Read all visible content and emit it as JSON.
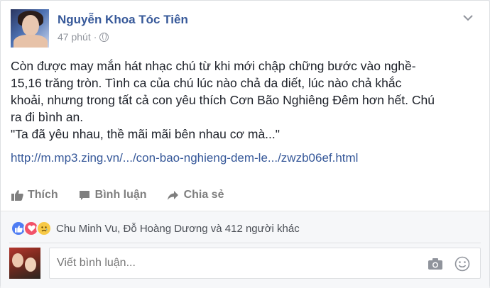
{
  "post": {
    "author": "Nguyễn Khoa Tóc Tiên",
    "time": "47 phút",
    "separator": "·",
    "privacy_icon": "globe-icon",
    "menu_icon": "chevron-down-icon",
    "text_lines": [
      "Còn được may mắn hát nhạc chú từ khi mới chập chững bước vào nghề-",
      "15,16 trăng tròn. Tình ca của chú lúc nào chả da diết, lúc nào chả khắc",
      "khoải, nhưng trong tất cả con yêu thích Cơn Bão Nghiêng Đêm hơn hết. Chú",
      "ra đi bình an.",
      "\"Ta đã yêu nhau, thề mãi mãi bên nhau cơ mà...\""
    ],
    "link": "http://m.mp3.zing.vn/.../con-bao-nghieng-dem-le.../zwzb06ef.html"
  },
  "actions": {
    "like": "Thích",
    "comment": "Bình luận",
    "share": "Chia sẻ"
  },
  "reactions": {
    "icons": [
      "like-icon",
      "love-icon",
      "sad-icon"
    ],
    "summary": "Chu Minh Vu, Đỗ Hoàng Dương và 412 người khác"
  },
  "comment": {
    "placeholder": "Viết bình luận..."
  },
  "colors": {
    "link": "#365899",
    "secondary": "#90949c",
    "action": "#7f7f7f",
    "like": "#4f7df3",
    "love": "#f25268",
    "sad": "#f7c947"
  }
}
